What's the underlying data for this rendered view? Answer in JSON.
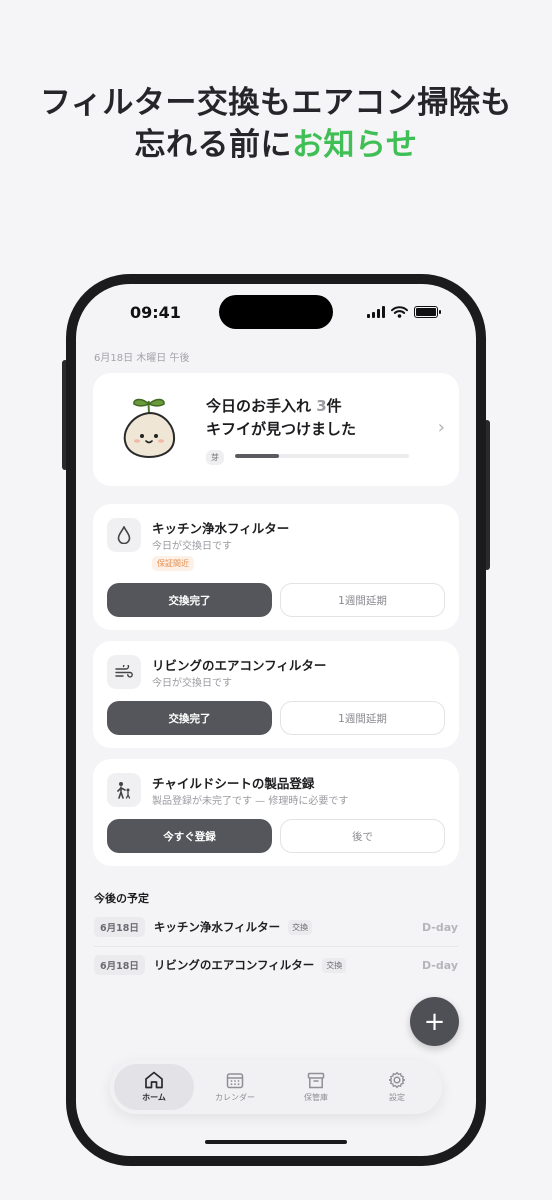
{
  "headline": {
    "line1": "フィルター交換もエアコン掃除も",
    "line2_prefix": "忘れる前に",
    "line2_accent": "お知らせ"
  },
  "status_bar": {
    "time": "09:41"
  },
  "date_label": "6月18日 木曜日 午後",
  "hero": {
    "title_prefix": "今日のお手入れ ",
    "count": "3",
    "title_suffix": "件",
    "subtitle": "キフイが見つけました",
    "stage_tag": "芽",
    "progress": 0.25
  },
  "tasks": [
    {
      "icon": "water-drop-icon",
      "title": "キッチン浄水フィルター",
      "subtitle": "今日が交換日です",
      "badge": "保証間近",
      "primary": "交換完了",
      "secondary": "1週間延期"
    },
    {
      "icon": "wind-icon",
      "title": "リビングのエアコンフィルター",
      "subtitle": "今日が交換日です",
      "primary": "交換完了",
      "secondary": "1週間延期"
    },
    {
      "icon": "child-icon",
      "title": "チャイルドシートの製品登録",
      "subtitle": "製品登録が未完了です — 修理時に必要です",
      "primary": "今すぐ登録",
      "secondary": "後で"
    }
  ],
  "upcoming": {
    "title": "今後の予定",
    "items": [
      {
        "date": "6月18日",
        "name": "キッチン浄水フィルター",
        "tag": "交換",
        "dday": "D-day"
      },
      {
        "date": "6月18日",
        "name": "リビングのエアコンフィルター",
        "tag": "交換",
        "dday": "D-day"
      }
    ]
  },
  "fab_label": "+",
  "tabs": [
    {
      "label": "ホーム",
      "icon": "home-icon",
      "active": true
    },
    {
      "label": "カレンダー",
      "icon": "calendar-icon",
      "active": false
    },
    {
      "label": "保管庫",
      "icon": "archive-icon",
      "active": false
    },
    {
      "label": "設定",
      "icon": "gear-icon",
      "active": false
    }
  ],
  "colors": {
    "accent": "#3fbf55",
    "primary_button": "#55565b",
    "badge_text": "#e58b4c"
  }
}
